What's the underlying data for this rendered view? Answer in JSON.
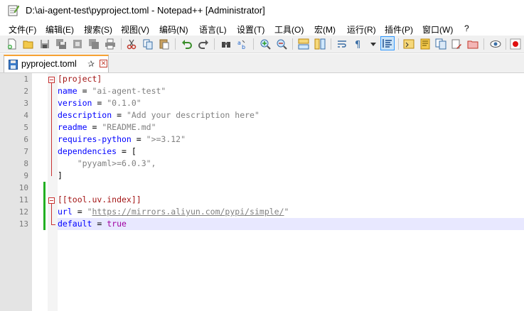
{
  "window": {
    "title": "D:\\ai-agent-test\\pyproject.toml - Notepad++ [Administrator]"
  },
  "menu": [
    {
      "label": "文件(F)"
    },
    {
      "label": "编辑(E)"
    },
    {
      "label": "搜索(S)"
    },
    {
      "label": "视图(V)"
    },
    {
      "label": "编码(N)"
    },
    {
      "label": "语言(L)"
    },
    {
      "label": "设置(T)"
    },
    {
      "label": "工具(O)"
    },
    {
      "label": "宏(M)"
    },
    {
      "label": "运行(R)"
    },
    {
      "label": "插件(P)"
    },
    {
      "label": "窗口(W)"
    },
    {
      "label": "?"
    }
  ],
  "toolbar": {
    "icons": [
      "new-file-icon",
      "open-file-icon",
      "save-icon",
      "save-all-icon",
      "close-icon",
      "close-all-icon",
      "print-icon",
      "cut-icon",
      "copy-icon",
      "paste-icon",
      "undo-icon",
      "redo-icon",
      "find-icon",
      "replace-icon",
      "zoom-in-icon",
      "zoom-out-icon",
      "sync-vertical-icon",
      "sync-horizontal-icon",
      "word-wrap-icon",
      "show-all-chars-icon",
      "indent-guide-icon",
      "user-language-icon",
      "document-map-icon",
      "function-list-icon",
      "folder-as-workspace-icon",
      "monitoring-icon",
      "record-macro-icon"
    ]
  },
  "tabs": [
    {
      "label": "pyproject.toml",
      "pin": "✰",
      "close": "✕"
    }
  ],
  "editor": {
    "line_numbers": [
      "1",
      "2",
      "3",
      "4",
      "5",
      "6",
      "7",
      "8",
      "9",
      "10",
      "11",
      "12",
      "13"
    ],
    "lines": [
      [
        {
          "t": "[project]",
          "c": "sec"
        }
      ],
      [
        {
          "t": "name",
          "c": "key"
        },
        {
          "t": " = ",
          "c": "op"
        },
        {
          "t": "\"ai-agent-test\"",
          "c": "str"
        }
      ],
      [
        {
          "t": "version",
          "c": "key"
        },
        {
          "t": " = ",
          "c": "op"
        },
        {
          "t": "\"0.1.0\"",
          "c": "str"
        }
      ],
      [
        {
          "t": "description",
          "c": "key"
        },
        {
          "t": " = ",
          "c": "op"
        },
        {
          "t": "\"Add your description here\"",
          "c": "str"
        }
      ],
      [
        {
          "t": "readme",
          "c": "key"
        },
        {
          "t": " = ",
          "c": "op"
        },
        {
          "t": "\"README.md\"",
          "c": "str"
        }
      ],
      [
        {
          "t": "requires-python",
          "c": "key"
        },
        {
          "t": " = ",
          "c": "op"
        },
        {
          "t": "\">=3.12\"",
          "c": "str"
        }
      ],
      [
        {
          "t": "dependencies",
          "c": "key"
        },
        {
          "t": " = [",
          "c": "op"
        }
      ],
      [
        {
          "t": "    \"pyyaml>=6.0.3\",",
          "c": "str"
        }
      ],
      [
        {
          "t": "]",
          "c": "op"
        }
      ],
      [],
      [
        {
          "t": "[[tool.uv.index]]",
          "c": "sec"
        }
      ],
      [
        {
          "t": "url",
          "c": "key"
        },
        {
          "t": " = ",
          "c": "op"
        },
        {
          "t": "\"",
          "c": "str"
        },
        {
          "t": "https://mirrors.aliyun.com/pypi/simple/",
          "c": "url"
        },
        {
          "t": "\"",
          "c": "str"
        }
      ],
      [
        {
          "t": "default",
          "c": "key"
        },
        {
          "t": " = ",
          "c": "op"
        },
        {
          "t": "true",
          "c": "bool"
        }
      ]
    ],
    "current_line": 13
  },
  "colors": {
    "section": "#a31515",
    "key": "#0000ff",
    "string": "#808080",
    "boolean": "#a000a0",
    "current_line_bg": "#e8e8ff",
    "change_bar": "#22b022",
    "tab_accent": "#f7a233"
  }
}
